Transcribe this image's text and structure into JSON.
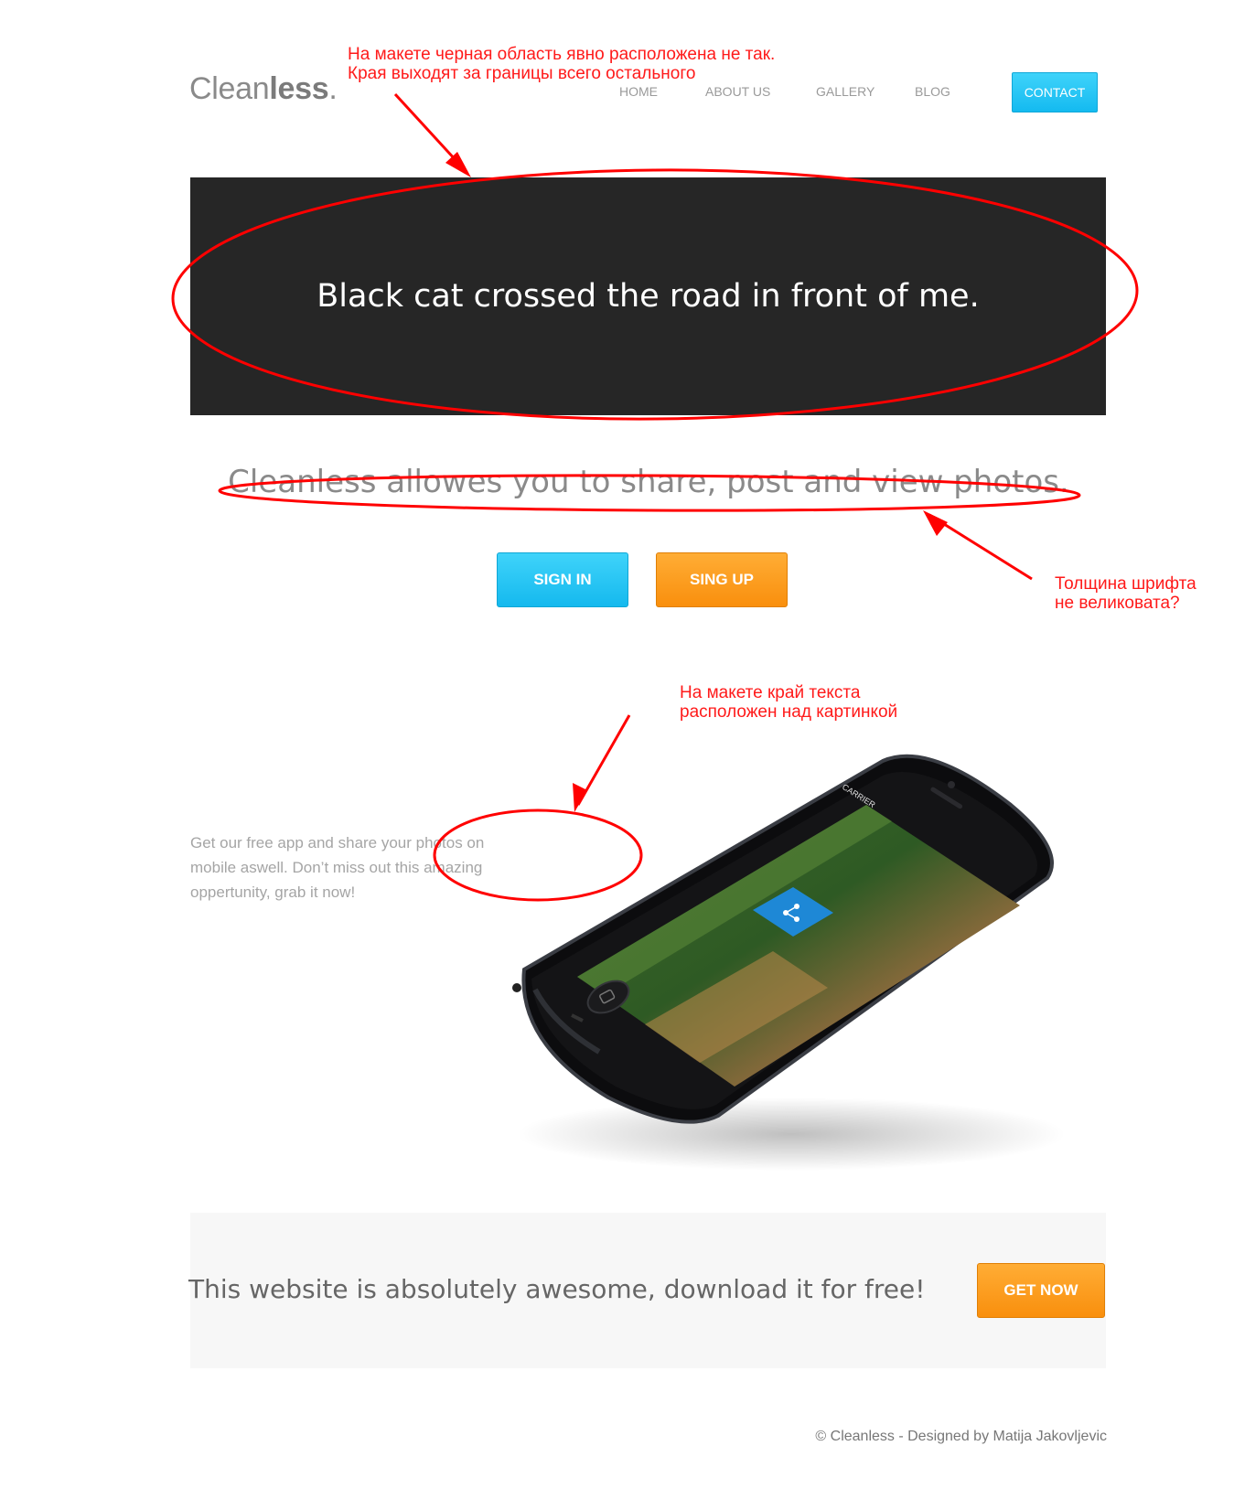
{
  "header": {
    "logo_light": "Clean",
    "logo_bold": "less",
    "logo_dot": ".",
    "nav": [
      "HOME",
      "ABOUT US",
      "GALLERY",
      "BLOG"
    ],
    "contact_label": "CONTACT"
  },
  "hero": {
    "text": "Black cat crossed the road in front of me."
  },
  "tagline": "Cleanless allowes you to share, post and view photos.",
  "buttons": {
    "sign_in": "SIGN IN",
    "sign_up": "SING UP",
    "get_now": "GET NOW"
  },
  "app_section": {
    "text": "Get our free app and share your photos on mobile aswell. Don’t miss out this amazing oppertunity, grab it now!",
    "phone_carrier": "CARRIER"
  },
  "promo": {
    "text": "This website is absolutely awesome, download it for free!"
  },
  "footer": {
    "text": "© Cleanless - Designed by Matija Jakovljevic"
  },
  "annotations": {
    "note1_line1": "На макете черная область явно расположена не так.",
    "note1_line2": "Края выходят за границы всего остального",
    "note2_line1": "Толщина шрифта",
    "note2_line2": "не великовата?",
    "note3_line1": "На макете край текста",
    "note3_line2": "расположен над картинкой"
  },
  "colors": {
    "hero_bg": "#262626",
    "accent_blue": "#14baf0",
    "accent_orange": "#f98f0d",
    "annotation_red": "#ff0000"
  }
}
